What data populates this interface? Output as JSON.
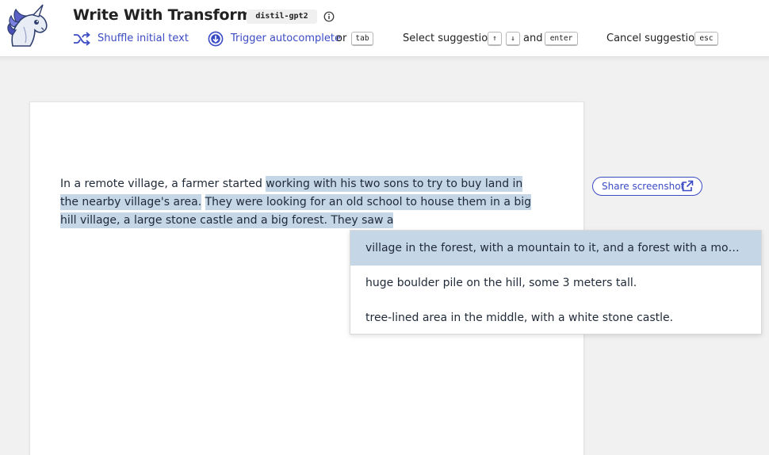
{
  "header": {
    "title": "Write With Transformer",
    "model": "distil-gpt2",
    "logo_icon": "unicorn-logo",
    "info_icon": "info-icon"
  },
  "toolbar": {
    "shuffle": {
      "label": "Shuffle initial text",
      "icon": "shuffle-icon"
    },
    "trigger": {
      "label": "Trigger autocomplete",
      "icon": "arrow-down-circle-icon"
    },
    "or_text": "or",
    "tab_key": "tab",
    "select_text": "Select suggestion",
    "up_key": "↑",
    "down_key": "↓",
    "and_text": "and",
    "enter_key": "enter",
    "cancel_text": "Cancel suggestion",
    "esc_key": "esc"
  },
  "editor": {
    "prompt": "In a remote village, a farmer started",
    "completion_1": "working with his two sons to try to buy land in the nearby village's area.",
    "completion_2": "They were looking for an old school to house them in a big hill village, a large stone castle and a big forest. They saw a"
  },
  "share": {
    "label": "Share screenshot",
    "icon": "external-link-icon"
  },
  "suggestions": [
    "village in the forest, with a mountain to it, and a forest with a mountain in the middle of it.",
    "huge boulder pile on the hill, some 3 meters tall.",
    "tree-lined area in the middle, with a white stone castle."
  ],
  "selected_suggestion_index": 0,
  "colors": {
    "accent": "#3b4bc4",
    "highlight": "#c5d6e6",
    "background": "#f1f1f2"
  }
}
